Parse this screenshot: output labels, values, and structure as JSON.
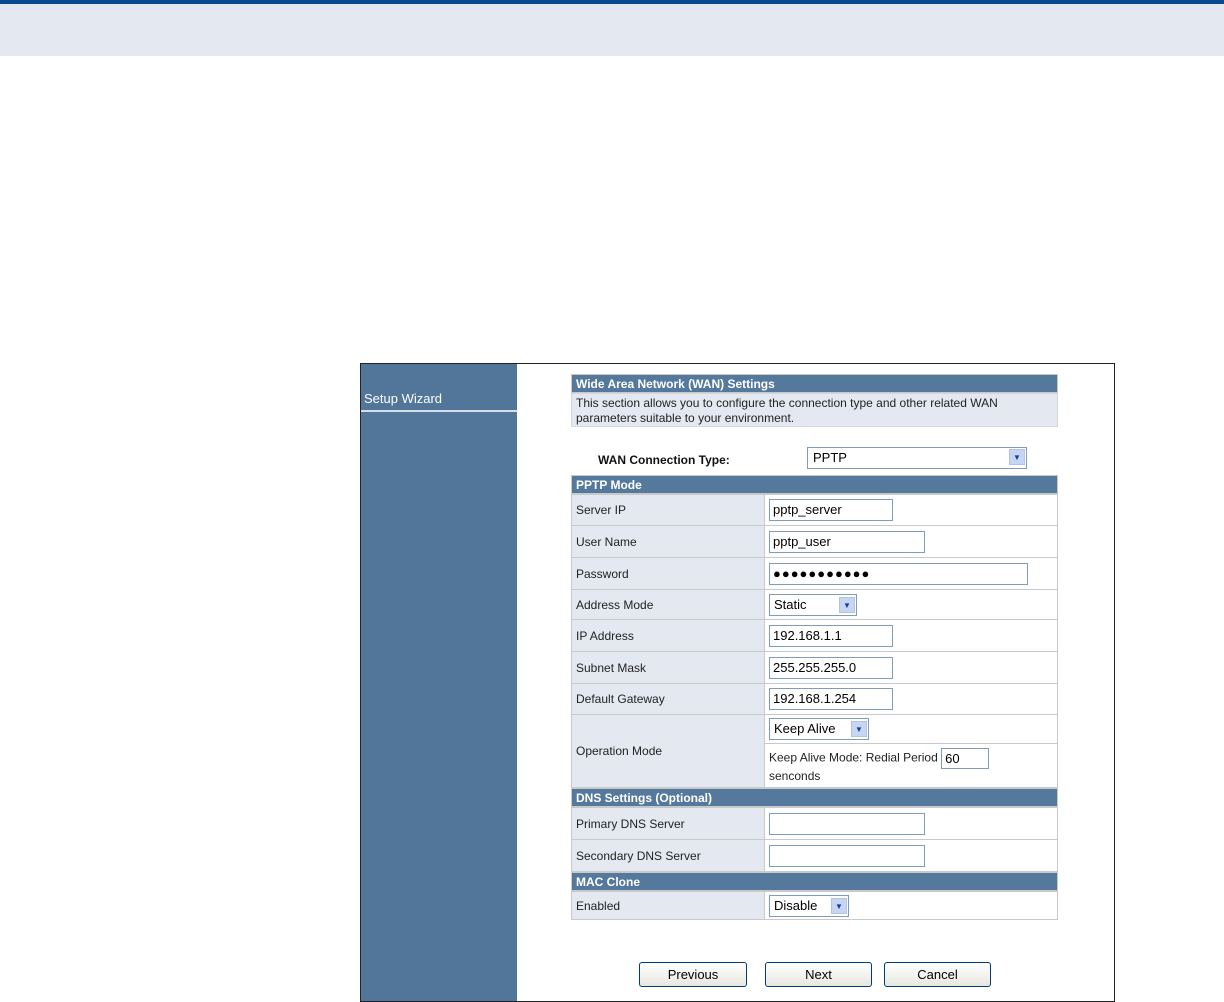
{
  "sidebar": {
    "items": [
      {
        "label": "Setup Wizard"
      }
    ]
  },
  "wan": {
    "title": "Wide Area Network (WAN) Settings",
    "description": "This section allows you to configure the connection type and other related WAN parameters suitable to your environment.",
    "connection_type_label": "WAN Connection Type:",
    "connection_type_value": "PPTP"
  },
  "pptp": {
    "title": "PPTP Mode",
    "server_ip": {
      "label": "Server IP",
      "value": "pptp_server"
    },
    "user_name": {
      "label": "User Name",
      "value": "pptp_user"
    },
    "password": {
      "label": "Password",
      "value": "●●●●●●●●●●●"
    },
    "address_mode": {
      "label": "Address Mode",
      "value": "Static"
    },
    "ip_address": {
      "label": "IP Address",
      "value": "192.168.1.1"
    },
    "subnet_mask": {
      "label": "Subnet Mask",
      "value": "255.255.255.0"
    },
    "default_gateway": {
      "label": "Default Gateway",
      "value": "192.168.1.254"
    },
    "operation_mode": {
      "label": "Operation Mode",
      "value": "Keep Alive",
      "keep_alive_text": "Keep Alive Mode: Redial Period",
      "redial_period": "60",
      "unit": "senconds"
    }
  },
  "dns": {
    "title": "DNS Settings (Optional)",
    "primary": {
      "label": "Primary DNS Server",
      "value": ""
    },
    "secondary": {
      "label": "Secondary DNS Server",
      "value": ""
    }
  },
  "mac": {
    "title": "MAC Clone",
    "enabled": {
      "label": "Enabled",
      "value": "Disable"
    }
  },
  "buttons": {
    "previous": "Previous",
    "next": "Next",
    "cancel": "Cancel"
  },
  "colors": {
    "header_blue": "#55799c",
    "sidebar_blue": "#52769a",
    "label_bg": "#e3e8f1",
    "top_line": "#0a4a8c"
  }
}
